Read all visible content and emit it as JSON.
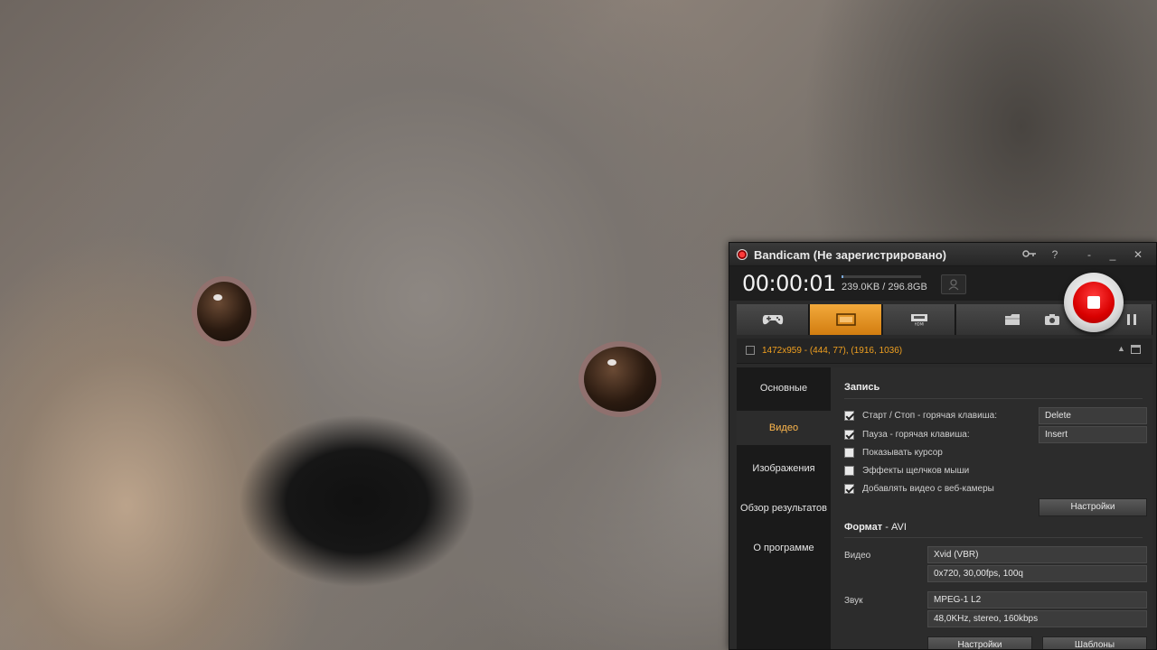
{
  "window": {
    "title": "Bandicam (Не зарегистрировано)"
  },
  "header": {
    "timer": "00:00:01",
    "file_size": "239.0KB / 296.8GB",
    "disk_usage_fraction": 0.001
  },
  "capture_region": "1472x959 - (444, 77), (1916, 1036)",
  "sidebar": {
    "items": [
      {
        "label": "Основные",
        "active": false
      },
      {
        "label": "Видео",
        "active": true
      },
      {
        "label": "Изображения",
        "active": false
      },
      {
        "label": "Обзор результатов",
        "active": false
      },
      {
        "label": "О программе",
        "active": false
      }
    ]
  },
  "record": {
    "title": "Запись",
    "options": [
      {
        "label": "Старт / Стоп - горячая клавиша:",
        "checked": true,
        "value": "Delete"
      },
      {
        "label": "Пауза - горячая клавиша:",
        "checked": true,
        "value": "Insert"
      },
      {
        "label": "Показывать курсор",
        "checked": false
      },
      {
        "label": "Эффекты щелчков мыши",
        "checked": false
      },
      {
        "label": "Добавлять видео с веб-камеры",
        "checked": true
      }
    ],
    "settings_button": "Настройки"
  },
  "format": {
    "title": "Формат",
    "container_sep": " - ",
    "container": "AVI",
    "video_label": "Видео",
    "video_codec": "Xvid (VBR)",
    "video_details": "0x720, 30,00fps, 100q",
    "audio_label": "Звук",
    "audio_codec": "MPEG-1 L2",
    "audio_details": "48,0KHz, stereo, 160kbps",
    "settings_button": "Настройки",
    "templates_button": "Шаблоны"
  },
  "colors": {
    "accent_orange": "#e8941f",
    "record_red": "#d90000",
    "region_text": "#f0a020"
  },
  "icons": {
    "mode_tabs": [
      "gamepad-icon",
      "screen-rect-icon",
      "hdmi-device-icon"
    ],
    "tools": [
      "folder-icon",
      "camera-icon",
      "pause-icon"
    ]
  }
}
